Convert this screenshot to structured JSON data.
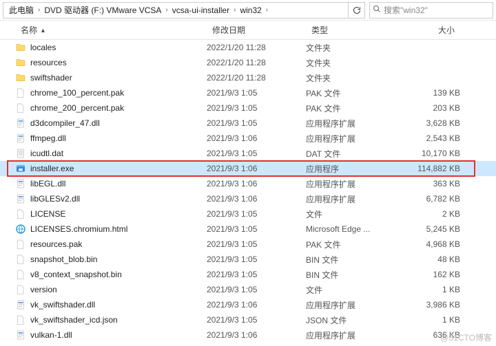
{
  "breadcrumb": [
    "此电脑",
    "DVD 驱动器 (F:) VMware VCSA",
    "vcsa-ui-installer",
    "win32"
  ],
  "search": {
    "placeholder": "搜索\"win32\""
  },
  "columns": {
    "name": "名称",
    "date": "修改日期",
    "type": "类型",
    "size": "大小",
    "sort_asc": "▲"
  },
  "watermark": "@51CTO博客",
  "icons": {
    "folder": "folder",
    "generic": "file",
    "dll": "dll",
    "dat": "dat",
    "exe": "exe",
    "html": "html"
  },
  "files": [
    {
      "name": "locales",
      "date": "2022/1/20 11:28",
      "type": "文件夹",
      "size": "",
      "icon": "folder"
    },
    {
      "name": "resources",
      "date": "2022/1/20 11:28",
      "type": "文件夹",
      "size": "",
      "icon": "folder"
    },
    {
      "name": "swiftshader",
      "date": "2022/1/20 11:28",
      "type": "文件夹",
      "size": "",
      "icon": "folder"
    },
    {
      "name": "chrome_100_percent.pak",
      "date": "2021/9/3 1:05",
      "type": "PAK 文件",
      "size": "139 KB",
      "icon": "generic"
    },
    {
      "name": "chrome_200_percent.pak",
      "date": "2021/9/3 1:05",
      "type": "PAK 文件",
      "size": "203 KB",
      "icon": "generic"
    },
    {
      "name": "d3dcompiler_47.dll",
      "date": "2021/9/3 1:05",
      "type": "应用程序扩展",
      "size": "3,628 KB",
      "icon": "dll"
    },
    {
      "name": "ffmpeg.dll",
      "date": "2021/9/3 1:06",
      "type": "应用程序扩展",
      "size": "2,543 KB",
      "icon": "dll"
    },
    {
      "name": "icudtl.dat",
      "date": "2021/9/3 1:05",
      "type": "DAT 文件",
      "size": "10,170 KB",
      "icon": "dat"
    },
    {
      "name": "installer.exe",
      "date": "2021/9/3 1:06",
      "type": "应用程序",
      "size": "114,882 KB",
      "icon": "exe",
      "selected": true
    },
    {
      "name": "libEGL.dll",
      "date": "2021/9/3 1:06",
      "type": "应用程序扩展",
      "size": "363 KB",
      "icon": "dll"
    },
    {
      "name": "libGLESv2.dll",
      "date": "2021/9/3 1:06",
      "type": "应用程序扩展",
      "size": "6,782 KB",
      "icon": "dll"
    },
    {
      "name": "LICENSE",
      "date": "2021/9/3 1:05",
      "type": "文件",
      "size": "2 KB",
      "icon": "generic"
    },
    {
      "name": "LICENSES.chromium.html",
      "date": "2021/9/3 1:05",
      "type": "Microsoft Edge ...",
      "size": "5,245 KB",
      "icon": "html"
    },
    {
      "name": "resources.pak",
      "date": "2021/9/3 1:05",
      "type": "PAK 文件",
      "size": "4,968 KB",
      "icon": "generic"
    },
    {
      "name": "snapshot_blob.bin",
      "date": "2021/9/3 1:05",
      "type": "BIN 文件",
      "size": "48 KB",
      "icon": "generic"
    },
    {
      "name": "v8_context_snapshot.bin",
      "date": "2021/9/3 1:05",
      "type": "BIN 文件",
      "size": "162 KB",
      "icon": "generic"
    },
    {
      "name": "version",
      "date": "2021/9/3 1:05",
      "type": "文件",
      "size": "1 KB",
      "icon": "generic"
    },
    {
      "name": "vk_swiftshader.dll",
      "date": "2021/9/3 1:06",
      "type": "应用程序扩展",
      "size": "3,986 KB",
      "icon": "dll"
    },
    {
      "name": "vk_swiftshader_icd.json",
      "date": "2021/9/3 1:05",
      "type": "JSON 文件",
      "size": "1 KB",
      "icon": "generic"
    },
    {
      "name": "vulkan-1.dll",
      "date": "2021/9/3 1:06",
      "type": "应用程序扩展",
      "size": "636 KB",
      "icon": "dll"
    }
  ]
}
